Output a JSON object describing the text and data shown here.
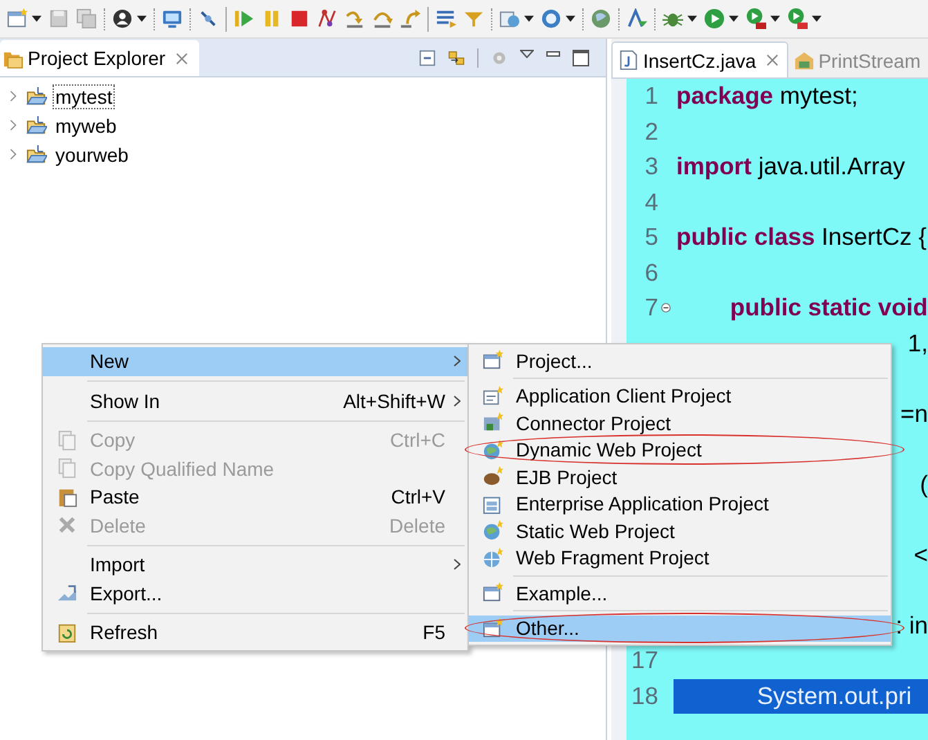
{
  "explorer": {
    "title": "Project Explorer",
    "items": [
      {
        "label": "mytest",
        "expanded": false,
        "selected": true
      },
      {
        "label": "myweb",
        "expanded": false,
        "selected": false
      },
      {
        "label": "yourweb",
        "expanded": false,
        "selected": false
      }
    ]
  },
  "editor": {
    "tabs": [
      {
        "label": "InsertCz.java",
        "selected": true
      },
      {
        "label": "PrintStream",
        "selected": false
      }
    ],
    "lines": [
      {
        "kind": "line",
        "number": "1",
        "code": "**package** mytest;"
      },
      {
        "kind": "line",
        "number": "2"
      },
      {
        "kind": "line",
        "number": "3",
        "code": "**import** java.util.Array"
      },
      {
        "kind": "line",
        "number": "4"
      },
      {
        "kind": "line",
        "number": "5",
        "code": "**public class** InsertCz {"
      },
      {
        "kind": "line",
        "number": "6"
      },
      {
        "kind": "line",
        "number": "7",
        "code": "        **public static void**",
        "folded": false
      },
      {
        "kind": "fragment",
        "code": "1,"
      },
      {
        "kind": "hidden"
      },
      {
        "kind": "fragment",
        "code": "=n"
      },
      {
        "kind": "hidden"
      },
      {
        "kind": "fragment",
        "code": "("
      },
      {
        "kind": "hidden"
      },
      {
        "kind": "fragment",
        "code": "<"
      },
      {
        "kind": "hidden"
      },
      {
        "kind": "fragment",
        "code": ": in"
      },
      {
        "kind": "line",
        "number": "17"
      },
      {
        "kind": "line",
        "number": "18",
        "code": "            System.out.pri",
        "current": true
      }
    ]
  },
  "context_menu": [
    {
      "kind": "item",
      "label": "New",
      "submenu": true,
      "disabled": false,
      "selected": true
    },
    {
      "kind": "separator"
    },
    {
      "kind": "item",
      "label": "Show In",
      "shortcut": "Alt+Shift+W",
      "submenu": true,
      "disabled": false,
      "selected": false
    },
    {
      "kind": "separator"
    },
    {
      "kind": "item",
      "label": "Copy",
      "shortcut": "Ctrl+C",
      "submenu": false,
      "disabled": true,
      "selected": false
    },
    {
      "kind": "item",
      "label": "Copy Qualified Name",
      "submenu": false,
      "disabled": true,
      "selected": false
    },
    {
      "kind": "item",
      "label": "Paste",
      "shortcut": "Ctrl+V",
      "submenu": false,
      "disabled": false,
      "selected": false
    },
    {
      "kind": "item",
      "label": "Delete",
      "shortcut": "Delete",
      "submenu": false,
      "disabled": true,
      "selected": false
    },
    {
      "kind": "separator"
    },
    {
      "kind": "item",
      "label": "Import",
      "submenu": true,
      "disabled": false,
      "selected": false
    },
    {
      "kind": "item",
      "label": "Export...",
      "submenu": false,
      "disabled": false,
      "selected": false
    },
    {
      "kind": "separator"
    },
    {
      "kind": "item",
      "label": "Refresh",
      "shortcut": "F5",
      "submenu": false,
      "disabled": false,
      "selected": false
    }
  ],
  "new_submenu": [
    {
      "kind": "item",
      "label": "Project...",
      "selected": false,
      "circled": false
    },
    {
      "kind": "separator"
    },
    {
      "kind": "item",
      "label": "Application Client Project",
      "selected": false,
      "circled": false
    },
    {
      "kind": "item",
      "label": "Connector Project",
      "selected": false,
      "circled": false
    },
    {
      "kind": "item",
      "label": "Dynamic Web Project",
      "selected": false,
      "circled": true
    },
    {
      "kind": "item",
      "label": "EJB Project",
      "selected": false,
      "circled": false
    },
    {
      "kind": "item",
      "label": "Enterprise Application Project",
      "selected": false,
      "circled": false
    },
    {
      "kind": "item",
      "label": "Static Web Project",
      "selected": false,
      "circled": false
    },
    {
      "kind": "item",
      "label": "Web Fragment Project",
      "selected": false,
      "circled": false
    },
    {
      "kind": "separator"
    },
    {
      "kind": "item",
      "label": "Example...",
      "selected": false,
      "circled": false
    },
    {
      "kind": "separator"
    },
    {
      "kind": "item",
      "label": "Other...",
      "selected": true,
      "circled": true
    }
  ]
}
